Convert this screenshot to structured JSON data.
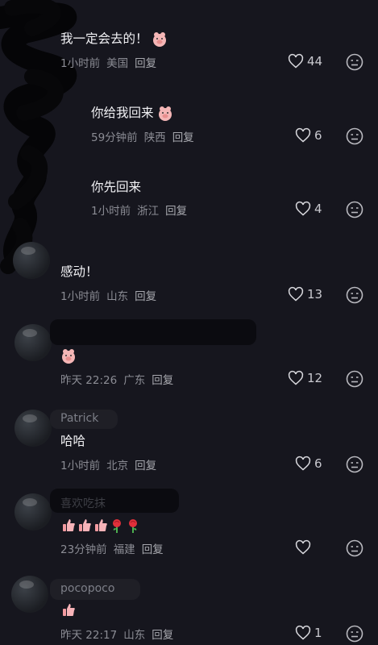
{
  "comments": [
    {
      "name": "",
      "text": "我一定会去的！",
      "emoji": "pig",
      "time": "1小时前",
      "region": "美国",
      "reply": "回复",
      "likes": "44"
    },
    {
      "name": "",
      "text": "你给我回来",
      "emoji": "pig",
      "time": "59分钟前",
      "region": "陕西",
      "reply": "回复",
      "likes": "6"
    },
    {
      "name": "",
      "text": "你先回来",
      "emoji": "",
      "time": "1小时前",
      "region": "浙江",
      "reply": "回复",
      "likes": "4"
    },
    {
      "name": "",
      "text": "感动！",
      "emoji": "",
      "time": "1小时前",
      "region": "山东",
      "reply": "回复",
      "likes": "13"
    },
    {
      "name": "",
      "text": "",
      "emoji": "pig",
      "time": "昨天 22:26",
      "region": "广东",
      "reply": "回复",
      "likes": "12"
    },
    {
      "name": "Patrick",
      "text": "哈哈",
      "emoji": "",
      "time": "1小时前",
      "region": "北京",
      "reply": "回复",
      "likes": "6"
    },
    {
      "name": "喜欢吃抹",
      "text": "",
      "emoji": "thumbs-roses",
      "time": "23分钟前",
      "region": "福建",
      "reply": "回复",
      "likes": ""
    },
    {
      "name": "pocopoco",
      "text": "",
      "emoji": "thumb",
      "time": "昨天 22:17",
      "region": "山东",
      "reply": "回复",
      "likes": "1"
    }
  ],
  "icons": {
    "like": "heart-outline-icon",
    "dislike": "neutral-face-icon"
  },
  "colors": {
    "background": "#16161e",
    "text": "#f2f2f5",
    "meta": "#8b8c94"
  }
}
